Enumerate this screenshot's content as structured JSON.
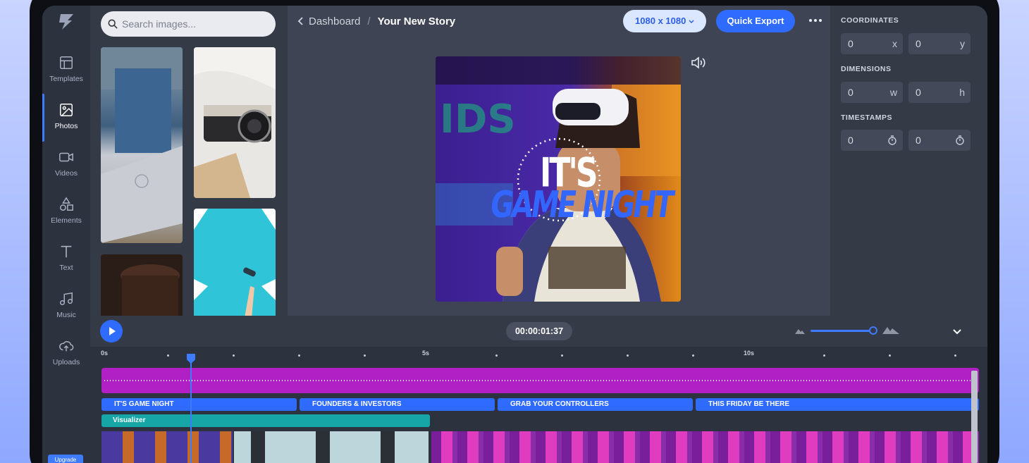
{
  "colors": {
    "accent": "#2f6bff",
    "audio": "#b020c4",
    "visualizer": "#16a6a8",
    "panel": "#353a47"
  },
  "sidebar": {
    "items": [
      {
        "label": "Templates",
        "icon": "template-icon"
      },
      {
        "label": "Photos",
        "icon": "photo-icon",
        "active": true
      },
      {
        "label": "Videos",
        "icon": "video-icon"
      },
      {
        "label": "Elements",
        "icon": "shapes-icon"
      },
      {
        "label": "Text",
        "icon": "text-icon"
      },
      {
        "label": "Music",
        "icon": "music-icon"
      },
      {
        "label": "Uploads",
        "icon": "upload-icon"
      }
    ],
    "upgrade": "Upgrade"
  },
  "media": {
    "search_placeholder": "Search images..."
  },
  "header": {
    "back": "Dashboard",
    "separator": "/",
    "title": "Your New Story",
    "size": "1080 x 1080",
    "export": "Quick Export"
  },
  "canvas": {
    "line1": "IT'S",
    "line2": "GAME NIGHT"
  },
  "props": {
    "coordinates": {
      "label": "COORDINATES",
      "x": "0",
      "x_unit": "x",
      "y": "0",
      "y_unit": "y"
    },
    "dimensions": {
      "label": "DIMENSIONS",
      "w": "0",
      "w_unit": "w",
      "h": "0",
      "h_unit": "h"
    },
    "timestamps": {
      "label": "TIMESTAMPS",
      "start": "0",
      "end": "0"
    }
  },
  "timeline": {
    "current_time": "00:00:01:37",
    "ticks": [
      "0s",
      "5s",
      "10s"
    ],
    "text_clips": [
      "IT'S GAME NIGHT",
      "FOUNDERS & INVESTORS",
      "GRAB YOUR CONTROLLERS",
      "THIS FRIDAY BE THERE"
    ],
    "visualizer": "Visualizer"
  }
}
